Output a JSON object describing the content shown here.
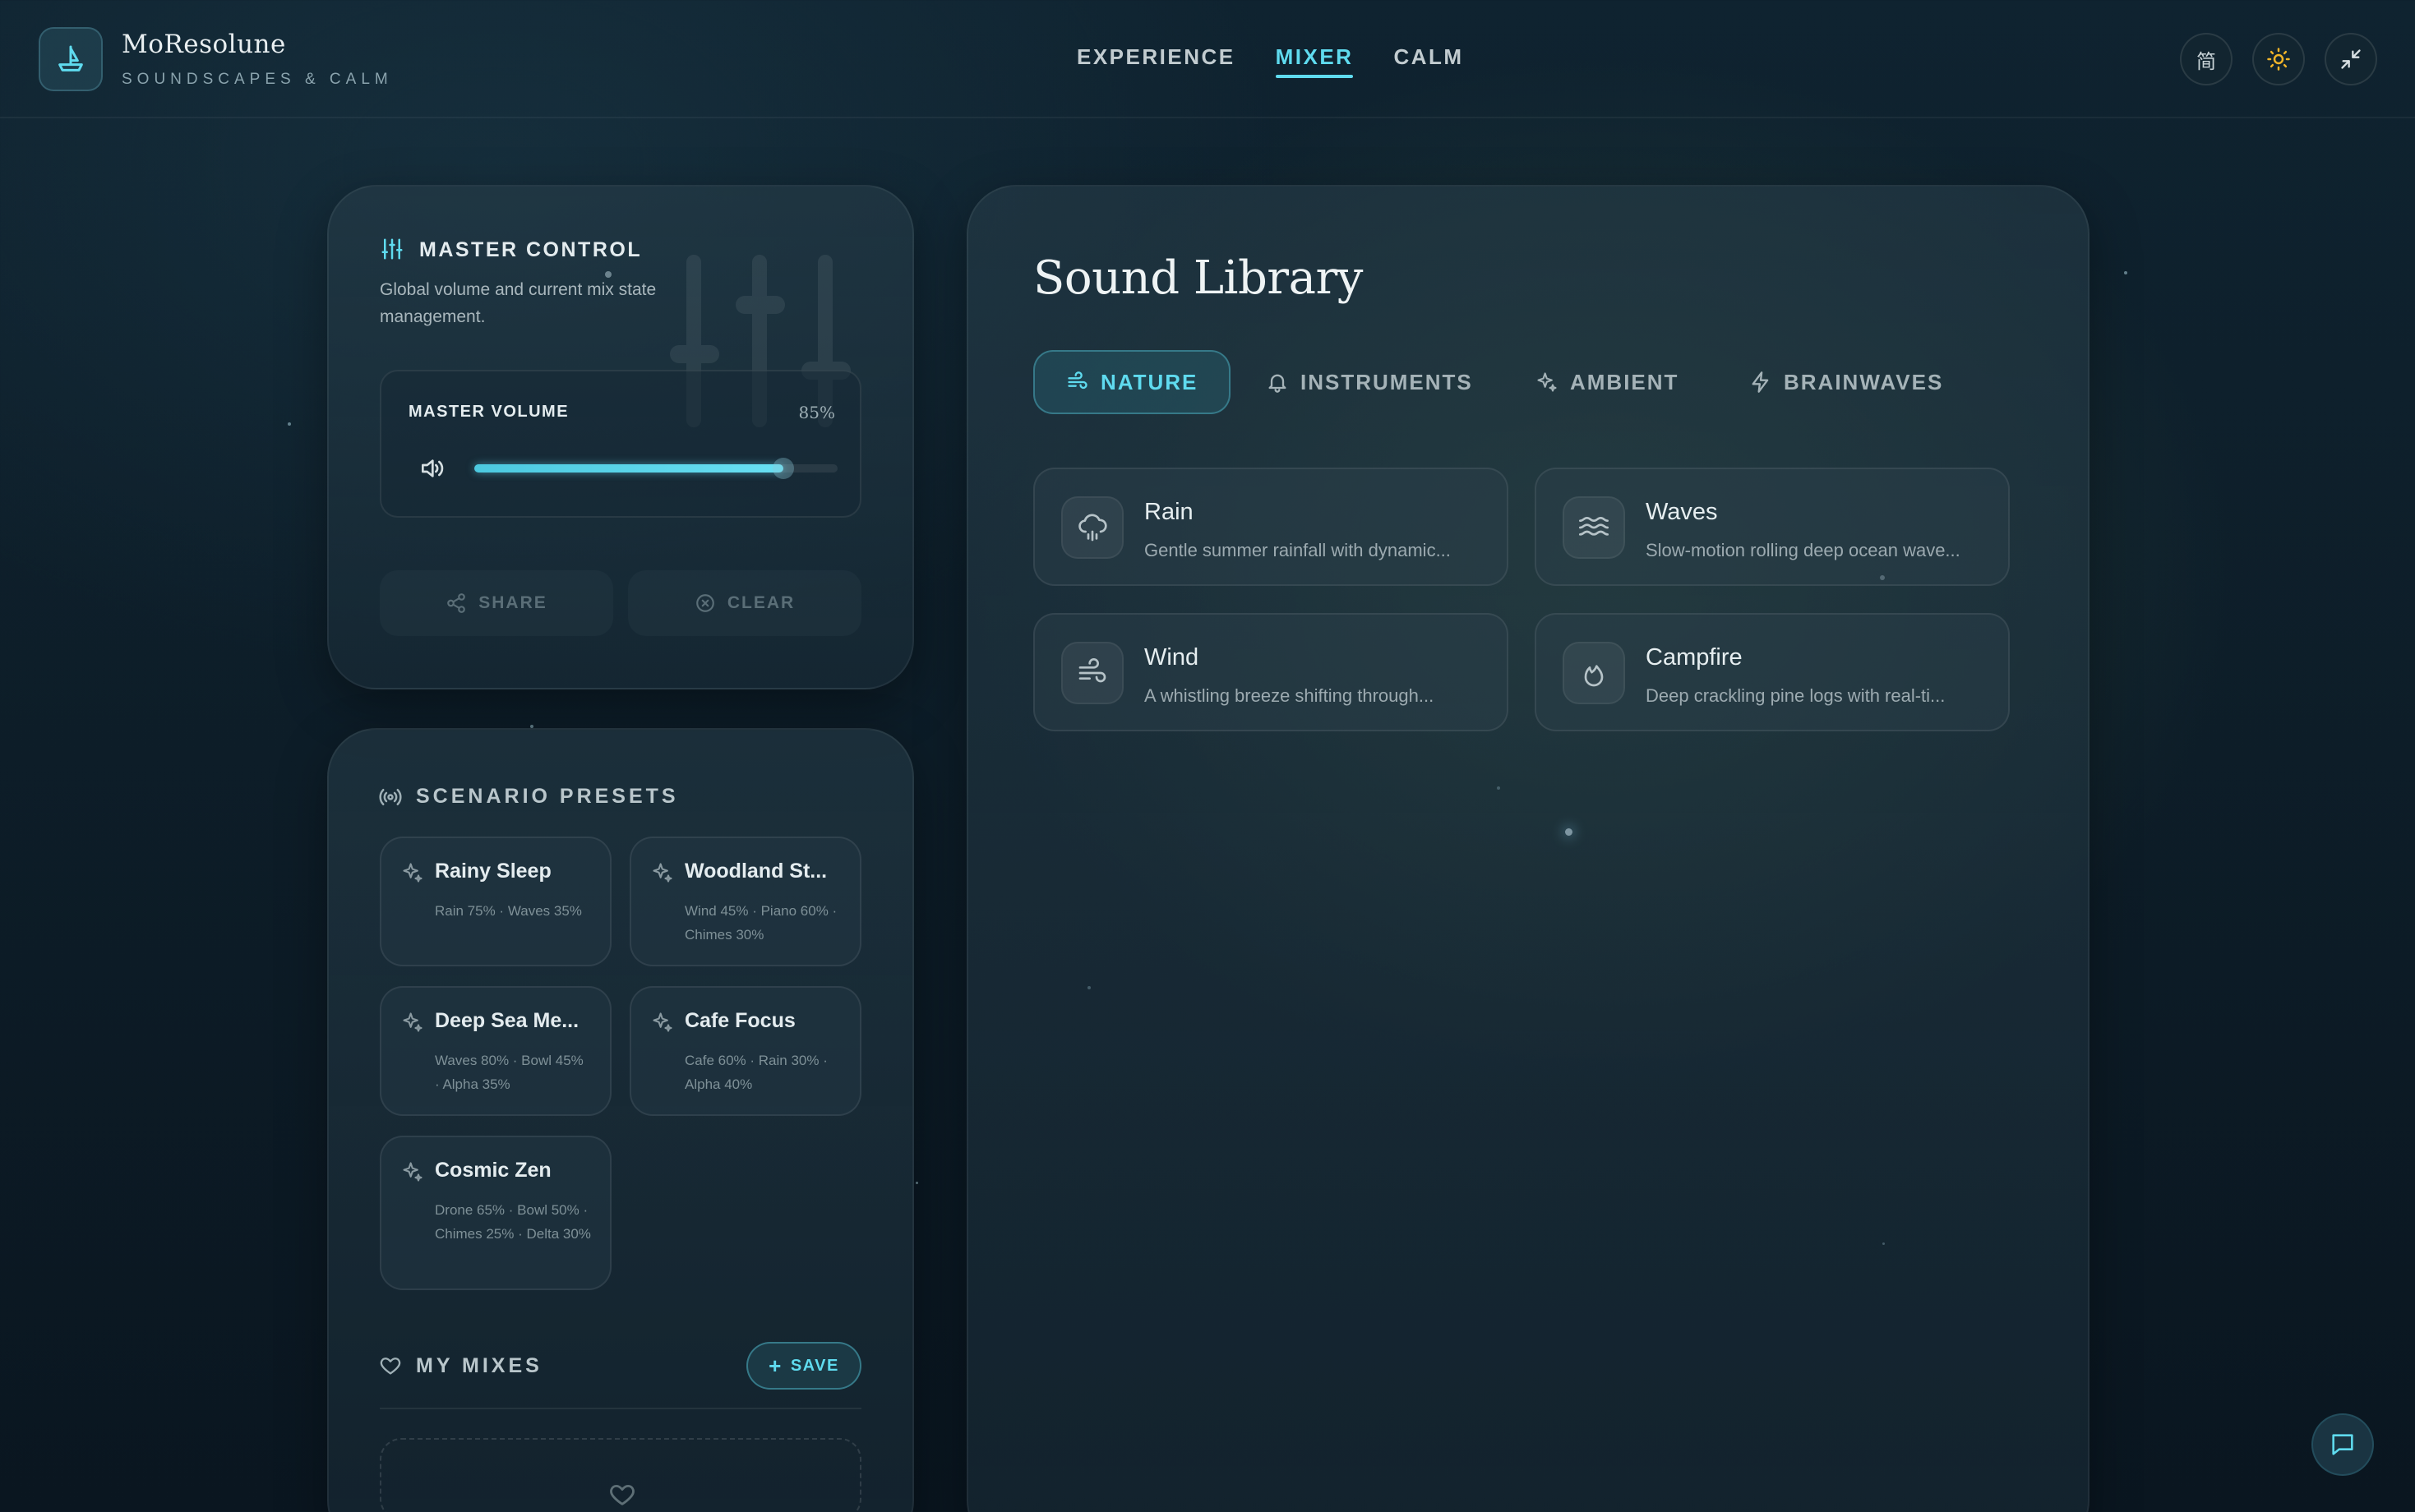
{
  "brand": {
    "name": "MoResolune",
    "tagline": "SOUNDSCAPES & CALM",
    "logo_icon": "boat-icon"
  },
  "nav": [
    {
      "label": "EXPERIENCE",
      "active": false
    },
    {
      "label": "MIXER",
      "active": true
    },
    {
      "label": "CALM",
      "active": false
    }
  ],
  "header_actions": {
    "language_label": "简",
    "theme_icon": "sun-icon",
    "collapse_icon": "minimize-icon",
    "accent_color": "#f0b429"
  },
  "master": {
    "title": "MASTER CONTROL",
    "subtitle": "Global volume and current mix state management.",
    "volume_label": "MASTER VOLUME",
    "volume_value": "85%",
    "volume_fraction": 0.85,
    "share_label": "SHARE",
    "clear_label": "CLEAR"
  },
  "presets": {
    "title": "SCENARIO PRESETS",
    "items": [
      {
        "name": "Rainy Sleep",
        "mix": "Rain 75% · Waves 35%"
      },
      {
        "name": "Woodland St...",
        "mix": "Wind 45% · Piano 60% · Chimes 30%"
      },
      {
        "name": "Deep Sea Me...",
        "mix": "Waves 80% · Bowl 45% · Alpha 35%"
      },
      {
        "name": "Cafe Focus",
        "mix": "Cafe 60% · Rain 30% · Alpha 40%"
      },
      {
        "name": "Cosmic Zen",
        "mix": "Drone 65% · Bowl 50% · Chimes 25% · Delta 30%"
      }
    ]
  },
  "my_mixes": {
    "title": "MY MIXES",
    "save_label": "SAVE"
  },
  "library": {
    "title": "Sound Library",
    "tabs": [
      {
        "label": "NATURE",
        "icon": "wind-icon",
        "active": true
      },
      {
        "label": "INSTRUMENTS",
        "icon": "bell-icon",
        "active": false
      },
      {
        "label": "AMBIENT",
        "icon": "sparkles-icon",
        "active": false
      },
      {
        "label": "BRAINWAVES",
        "icon": "bolt-icon",
        "active": false
      }
    ],
    "sounds": [
      {
        "name": "Rain",
        "desc": "Gentle summer rainfall with dynamic...",
        "icon": "cloud-rain-icon"
      },
      {
        "name": "Waves",
        "desc": "Slow-motion rolling deep ocean wave...",
        "icon": "waves-icon"
      },
      {
        "name": "Wind",
        "desc": "A whistling breeze shifting through...",
        "icon": "wind-icon"
      },
      {
        "name": "Campfire",
        "desc": "Deep crackling pine logs with real-ti...",
        "icon": "flame-icon"
      }
    ]
  },
  "colors": {
    "accent": "#5fdbef",
    "background": "#0d1d28"
  }
}
